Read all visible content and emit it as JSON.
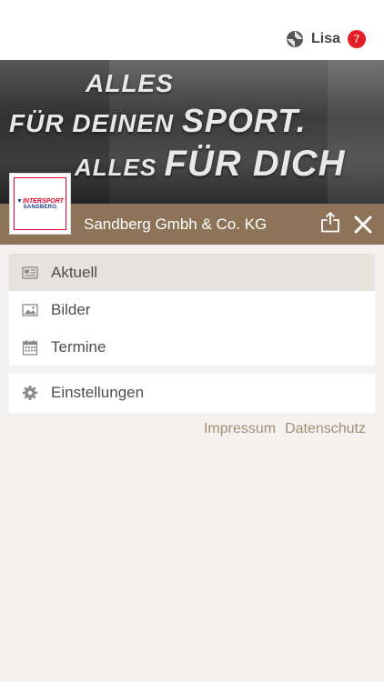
{
  "header": {
    "user_name": "Lisa",
    "notification_count": "7"
  },
  "hero": {
    "line1": "ALLES",
    "line2_a": "FÜR DEINEN ",
    "line2_b": "SPORT.",
    "line3_a": "ALLES ",
    "line3_b": "FÜR DICH"
  },
  "brand": {
    "logo_text_top": "INTERSPORT",
    "logo_text_bottom": "SANDBERG",
    "company_name": "Sandberg Gmbh & Co. KG"
  },
  "menu": {
    "items": [
      {
        "label": "Aktuell",
        "icon": "newspaper-icon",
        "active": true
      },
      {
        "label": "Bilder",
        "icon": "image-icon",
        "active": false
      },
      {
        "label": "Termine",
        "icon": "calendar-icon",
        "active": false
      }
    ],
    "settings": {
      "label": "Einstellungen",
      "icon": "gear-icon"
    }
  },
  "footer": {
    "impressum": "Impressum",
    "datenschutz": "Datenschutz"
  },
  "colors": {
    "brand_bar": "#8d7458",
    "badge": "#e32026",
    "link": "#a68d74",
    "active_item": "#e6e2dc"
  }
}
